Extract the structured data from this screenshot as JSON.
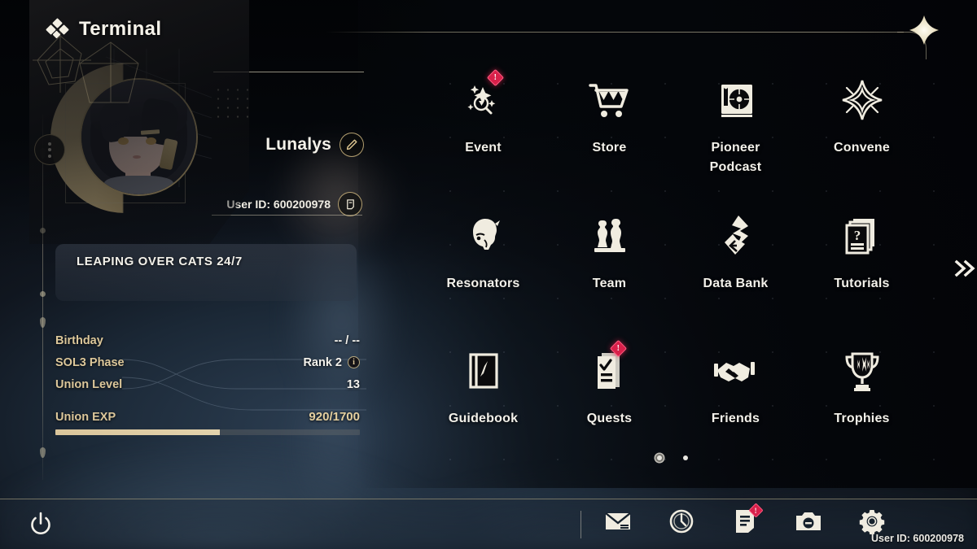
{
  "header": {
    "title": "Terminal",
    "icon": "diamond-cluster-icon",
    "close_icon": "close-star-icon"
  },
  "profile": {
    "avatar_icon": "player-avatar",
    "avatar_menu_icon": "more-vertical-icon",
    "name": "Lunalys",
    "edit_icon": "pencil-edit-icon",
    "user_id_label": "User ID: 600200978",
    "copy_icon": "copy-icon",
    "signature": "LEAPING OVER CATS 24/7",
    "stats": [
      {
        "label": "Birthday",
        "value": "-- / --",
        "info": false
      },
      {
        "label": "SOL3 Phase",
        "value": "Rank 2",
        "info": true,
        "info_icon": "info-icon"
      },
      {
        "label": "Union Level",
        "value": "13",
        "info": false
      }
    ],
    "exp": {
      "label": "Union EXP",
      "value": "920/1700",
      "current": 920,
      "max": 1700,
      "percent": 54
    }
  },
  "menu": {
    "items": [
      {
        "label": "Event",
        "icon": "sparkle-event-icon",
        "badge": "!"
      },
      {
        "label": "Store",
        "icon": "shopping-cart-icon",
        "badge": null
      },
      {
        "label": "Pioneer\nPodcast",
        "icon": "turntable-icon",
        "badge": null
      },
      {
        "label": "Convene",
        "icon": "four-point-star-icon",
        "badge": null
      },
      {
        "label": "Resonators",
        "icon": "character-head-icon",
        "badge": null
      },
      {
        "label": "Team",
        "icon": "chess-pieces-icon",
        "badge": null
      },
      {
        "label": "Data Bank",
        "icon": "data-bank-icon",
        "badge": null
      },
      {
        "label": "Tutorials",
        "icon": "question-pages-icon",
        "badge": null
      },
      {
        "label": "Guidebook",
        "icon": "compass-book-icon",
        "badge": null
      },
      {
        "label": "Quests",
        "icon": "checklist-icon",
        "badge": "!"
      },
      {
        "label": "Friends",
        "icon": "handshake-icon",
        "badge": null
      },
      {
        "label": "Trophies",
        "icon": "trophy-icon",
        "badge": null
      }
    ],
    "next_page_icon": "double-chevron-right-icon",
    "page_dots": [
      {
        "active": true
      },
      {
        "active": false
      }
    ]
  },
  "bottom_bar": {
    "power_icon": "power-icon",
    "icons": [
      {
        "name": "mail-icon",
        "badge": null
      },
      {
        "name": "clock-icon",
        "badge": null
      },
      {
        "name": "notes-icon",
        "badge": "!"
      },
      {
        "name": "camera-icon",
        "badge": null
      },
      {
        "name": "settings-gear-icon",
        "badge": null
      }
    ],
    "user_id": "User ID: 600200978"
  },
  "colors": {
    "gold": "#d9c28d",
    "cream": "#f3f1ea",
    "badge_red": "#d8204a",
    "panel_dark": "#0a0d12"
  }
}
